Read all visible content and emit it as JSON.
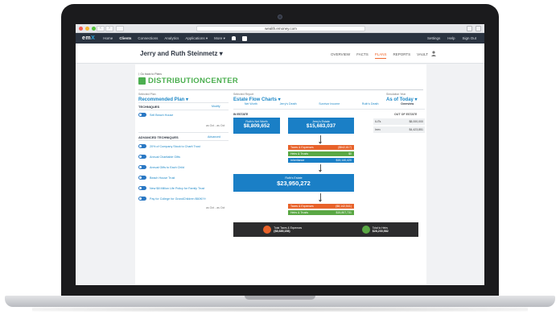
{
  "browser": {
    "url": "wealth.emoney.com"
  },
  "appbar": {
    "logo_prefix": "em",
    "logo_suffix": "X",
    "nav": [
      "Home",
      "Clients",
      "Connections",
      "Analytics",
      "Applications ▾",
      "More ▾"
    ],
    "right": [
      "Settings",
      "Help",
      "Sign Out"
    ]
  },
  "client": {
    "name": "Jerry and Ruth Steinmetz ▾",
    "tabs": [
      "OVERVIEW",
      "FACTS",
      "PLANS",
      "REPORTS",
      "VAULT"
    ],
    "selected_tab": "PLANS"
  },
  "page": {
    "back_link": "⟨ Go back to Plans",
    "title": "DISTRIBUTIONCENTER"
  },
  "selected_plan": {
    "label": "Selected Plan",
    "value": "Recommended Plan ▾"
  },
  "selected_report": {
    "label": "Selected Report",
    "value": "Estate Flow Charts ▾"
  },
  "simulation_year": {
    "label": "Simulation Year",
    "value": "As of Today ▾"
  },
  "techniques": {
    "heading": "TECHNIQUES",
    "modify": "Modify",
    "items": [
      "Sell Beach House"
    ],
    "timestamp": "as Oct - as Oct"
  },
  "advanced": {
    "heading": "ADVANCED TECHNIQUES",
    "link": "Advanced",
    "items": [
      "20% of Company Stock to Charit Trust",
      "Annual Charitable Gifts",
      "Annual Gifts to Each Child",
      "Beach House Trust",
      "New $8 Million Life Policy for Family Trust",
      "Pay for College for GrandChildren $60K/Yr"
    ],
    "timestamp": "as Oct - as Oct"
  },
  "report_tabs": [
    "Net Worth",
    "Jerry's Death",
    "Survivor Income",
    "Ruth's Death",
    "Overview"
  ],
  "active_report_tab": "Overview",
  "in_estate_label": "IN ESTATE",
  "out_of_estate": {
    "label": "OUT OF ESTATE",
    "rows": [
      {
        "name": "ILITs",
        "value": "$8,000,000"
      },
      {
        "name": "Irrev",
        "value": "$4,423,851"
      }
    ]
  },
  "flow": {
    "ruth_net_worth": {
      "label": "Ruth's Net Worth",
      "value": "$8,809,652"
    },
    "jerry_estate": {
      "label": "Jerry's Estate",
      "value": "$15,683,037"
    },
    "jerry_rows": [
      {
        "name": "Taxes & Expenses",
        "value": "($542,617)",
        "color": "#e8622a"
      },
      {
        "name": "Heirs & Trusts",
        "value": "$0",
        "color": "#5aa845"
      },
      {
        "name": "Inheritance",
        "value": "$15,140,420",
        "color": "#1a7fc6"
      }
    ],
    "ruth_estate": {
      "label": "Ruth's Estate",
      "value": "$23,950,272"
    },
    "ruth_rows": [
      {
        "name": "Taxes & Expenses",
        "value": "($8,142,541)",
        "color": "#e8622a"
      },
      {
        "name": "Heirs & Trusts",
        "value": "$15,807,731",
        "color": "#5aa845"
      }
    ]
  },
  "footer": {
    "taxes_label": "Total Taxes & Expenses",
    "taxes_value": "($8,685,158)",
    "heirs_label": "Total to Heirs",
    "heirs_value": "$28,230,582"
  },
  "colors": {
    "accent": "#1e88c7",
    "green": "#4caf50",
    "orange": "#e8622a",
    "navbar": "#2a3340"
  }
}
